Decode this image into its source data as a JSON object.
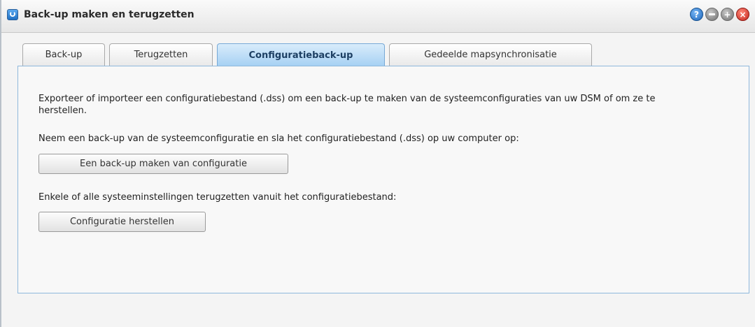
{
  "window": {
    "title": "Back-up maken en terugzetten",
    "icon": "backup-app-icon",
    "controls": [
      "help-icon",
      "minimize-icon",
      "maximize-icon",
      "close-icon"
    ]
  },
  "tabs": [
    {
      "label": "Back-up",
      "active": false
    },
    {
      "label": "Terugzetten",
      "active": false
    },
    {
      "label": "Configuratieback-up",
      "active": true
    },
    {
      "label": "Gedeelde mapsynchronisatie",
      "active": false
    }
  ],
  "content": {
    "intro": "Exporteer of importeer een configuratiebestand (.dss) om een back-up te maken van de systeemconfiguraties van uw DSM of om ze te herstellen.",
    "backup_text": "Neem een back-up van de systeemconfiguratie en sla het configuratiebestand (.dss) op uw computer op:",
    "backup_button": "Een back-up maken van configuratie",
    "restore_text": "Enkele of alle systeeminstellingen terugzetten vanuit het configuratiebestand:",
    "restore_button": "Configuratie herstellen"
  },
  "colors": {
    "active_tab": "#a5d0f3",
    "panel_border": "#8fb8dc",
    "close_button": "#c3231b",
    "help_button": "#1d64b9"
  }
}
